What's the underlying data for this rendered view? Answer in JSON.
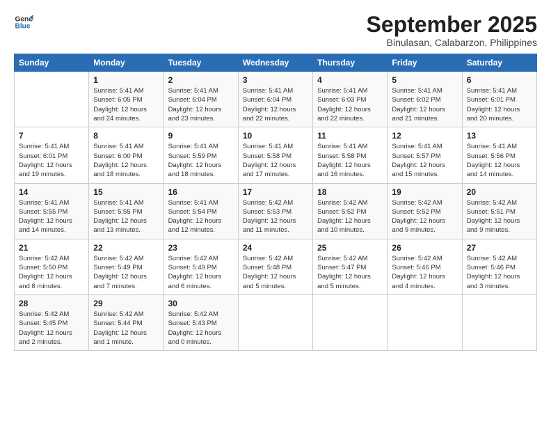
{
  "logo": {
    "line1": "General",
    "line2": "Blue"
  },
  "title": "September 2025",
  "location": "Binulasan, Calabarzon, Philippines",
  "days_header": [
    "Sunday",
    "Monday",
    "Tuesday",
    "Wednesday",
    "Thursday",
    "Friday",
    "Saturday"
  ],
  "weeks": [
    [
      {
        "num": "",
        "info": ""
      },
      {
        "num": "1",
        "info": "Sunrise: 5:41 AM\nSunset: 6:05 PM\nDaylight: 12 hours\nand 24 minutes."
      },
      {
        "num": "2",
        "info": "Sunrise: 5:41 AM\nSunset: 6:04 PM\nDaylight: 12 hours\nand 23 minutes."
      },
      {
        "num": "3",
        "info": "Sunrise: 5:41 AM\nSunset: 6:04 PM\nDaylight: 12 hours\nand 22 minutes."
      },
      {
        "num": "4",
        "info": "Sunrise: 5:41 AM\nSunset: 6:03 PM\nDaylight: 12 hours\nand 22 minutes."
      },
      {
        "num": "5",
        "info": "Sunrise: 5:41 AM\nSunset: 6:02 PM\nDaylight: 12 hours\nand 21 minutes."
      },
      {
        "num": "6",
        "info": "Sunrise: 5:41 AM\nSunset: 6:01 PM\nDaylight: 12 hours\nand 20 minutes."
      }
    ],
    [
      {
        "num": "7",
        "info": "Sunrise: 5:41 AM\nSunset: 6:01 PM\nDaylight: 12 hours\nand 19 minutes."
      },
      {
        "num": "8",
        "info": "Sunrise: 5:41 AM\nSunset: 6:00 PM\nDaylight: 12 hours\nand 18 minutes."
      },
      {
        "num": "9",
        "info": "Sunrise: 5:41 AM\nSunset: 5:59 PM\nDaylight: 12 hours\nand 18 minutes."
      },
      {
        "num": "10",
        "info": "Sunrise: 5:41 AM\nSunset: 5:58 PM\nDaylight: 12 hours\nand 17 minutes."
      },
      {
        "num": "11",
        "info": "Sunrise: 5:41 AM\nSunset: 5:58 PM\nDaylight: 12 hours\nand 16 minutes."
      },
      {
        "num": "12",
        "info": "Sunrise: 5:41 AM\nSunset: 5:57 PM\nDaylight: 12 hours\nand 15 minutes."
      },
      {
        "num": "13",
        "info": "Sunrise: 5:41 AM\nSunset: 5:56 PM\nDaylight: 12 hours\nand 14 minutes."
      }
    ],
    [
      {
        "num": "14",
        "info": "Sunrise: 5:41 AM\nSunset: 5:55 PM\nDaylight: 12 hours\nand 14 minutes."
      },
      {
        "num": "15",
        "info": "Sunrise: 5:41 AM\nSunset: 5:55 PM\nDaylight: 12 hours\nand 13 minutes."
      },
      {
        "num": "16",
        "info": "Sunrise: 5:41 AM\nSunset: 5:54 PM\nDaylight: 12 hours\nand 12 minutes."
      },
      {
        "num": "17",
        "info": "Sunrise: 5:42 AM\nSunset: 5:53 PM\nDaylight: 12 hours\nand 11 minutes."
      },
      {
        "num": "18",
        "info": "Sunrise: 5:42 AM\nSunset: 5:52 PM\nDaylight: 12 hours\nand 10 minutes."
      },
      {
        "num": "19",
        "info": "Sunrise: 5:42 AM\nSunset: 5:52 PM\nDaylight: 12 hours\nand 9 minutes."
      },
      {
        "num": "20",
        "info": "Sunrise: 5:42 AM\nSunset: 5:51 PM\nDaylight: 12 hours\nand 9 minutes."
      }
    ],
    [
      {
        "num": "21",
        "info": "Sunrise: 5:42 AM\nSunset: 5:50 PM\nDaylight: 12 hours\nand 8 minutes."
      },
      {
        "num": "22",
        "info": "Sunrise: 5:42 AM\nSunset: 5:49 PM\nDaylight: 12 hours\nand 7 minutes."
      },
      {
        "num": "23",
        "info": "Sunrise: 5:42 AM\nSunset: 5:49 PM\nDaylight: 12 hours\nand 6 minutes."
      },
      {
        "num": "24",
        "info": "Sunrise: 5:42 AM\nSunset: 5:48 PM\nDaylight: 12 hours\nand 5 minutes."
      },
      {
        "num": "25",
        "info": "Sunrise: 5:42 AM\nSunset: 5:47 PM\nDaylight: 12 hours\nand 5 minutes."
      },
      {
        "num": "26",
        "info": "Sunrise: 5:42 AM\nSunset: 5:46 PM\nDaylight: 12 hours\nand 4 minutes."
      },
      {
        "num": "27",
        "info": "Sunrise: 5:42 AM\nSunset: 5:46 PM\nDaylight: 12 hours\nand 3 minutes."
      }
    ],
    [
      {
        "num": "28",
        "info": "Sunrise: 5:42 AM\nSunset: 5:45 PM\nDaylight: 12 hours\nand 2 minutes."
      },
      {
        "num": "29",
        "info": "Sunrise: 5:42 AM\nSunset: 5:44 PM\nDaylight: 12 hours\nand 1 minute."
      },
      {
        "num": "30",
        "info": "Sunrise: 5:42 AM\nSunset: 5:43 PM\nDaylight: 12 hours\nand 0 minutes."
      },
      {
        "num": "",
        "info": ""
      },
      {
        "num": "",
        "info": ""
      },
      {
        "num": "",
        "info": ""
      },
      {
        "num": "",
        "info": ""
      }
    ]
  ]
}
